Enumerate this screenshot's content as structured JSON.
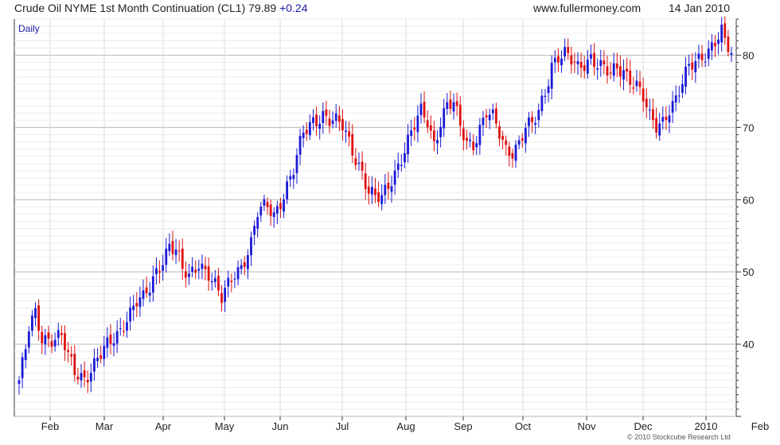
{
  "header": {
    "instrument": "Crude Oil NYME 1st Month Continuation (CL1)",
    "last_price": "79.89",
    "change": "+0.24",
    "website": "www.fullermoney.com",
    "date": "14 Jan 2010"
  },
  "period_label": "Daily",
  "copyright": "© 2010 Stockcube Research Ltd",
  "colors": {
    "up": "#1a1ad6",
    "down": "#e01010",
    "grid": "#d8d8d8",
    "axis": "#333333",
    "change": "#1a1aa8"
  },
  "chart_data": {
    "type": "candlestick",
    "y_axis_side": "right",
    "ylim": [
      30,
      85
    ],
    "y_ticks": [
      40,
      50,
      60,
      70,
      80
    ],
    "x_ticks": [
      "Feb",
      "Mar",
      "Apr",
      "May",
      "Jun",
      "Jul",
      "Aug",
      "Sep",
      "Oct",
      "Nov",
      "Dec",
      "2010",
      "Feb"
    ],
    "grid": true,
    "close_path": [
      [
        0,
        35
      ],
      [
        2,
        39
      ],
      [
        3,
        42
      ],
      [
        5,
        44
      ],
      [
        7,
        41
      ],
      [
        10,
        41
      ],
      [
        13,
        41
      ],
      [
        15,
        38
      ],
      [
        17,
        36
      ],
      [
        20,
        35.5
      ],
      [
        24,
        38
      ],
      [
        28,
        40
      ],
      [
        31,
        42
      ],
      [
        33,
        44
      ],
      [
        36,
        46
      ],
      [
        38,
        46
      ],
      [
        40,
        47.5
      ],
      [
        42,
        50
      ],
      [
        44,
        52
      ],
      [
        46,
        54
      ],
      [
        48,
        53
      ],
      [
        50,
        50
      ],
      [
        52,
        49
      ],
      [
        55,
        51.5
      ],
      [
        58,
        50
      ],
      [
        60,
        48
      ],
      [
        62,
        46
      ],
      [
        64,
        48
      ],
      [
        66,
        50
      ],
      [
        68,
        51
      ],
      [
        71,
        54
      ],
      [
        73,
        58
      ],
      [
        76,
        59
      ],
      [
        78,
        58
      ],
      [
        81,
        61
      ],
      [
        84,
        64
      ],
      [
        87,
        69
      ],
      [
        90,
        71
      ],
      [
        93,
        72
      ],
      [
        95,
        71
      ],
      [
        97,
        70.5
      ],
      [
        99,
        70
      ],
      [
        101,
        68
      ],
      [
        103,
        66
      ],
      [
        105,
        64
      ],
      [
        107,
        61
      ],
      [
        109,
        60
      ],
      [
        111,
        60
      ],
      [
        113,
        62
      ],
      [
        115,
        64
      ],
      [
        117,
        66
      ],
      [
        119,
        68
      ],
      [
        121,
        70
      ],
      [
        123,
        72
      ],
      [
        125,
        71
      ],
      [
        127,
        68
      ],
      [
        129,
        71
      ],
      [
        131,
        73
      ],
      [
        133,
        73
      ],
      [
        135,
        70
      ],
      [
        137,
        68
      ],
      [
        139,
        68
      ],
      [
        141,
        70
      ],
      [
        143,
        72
      ],
      [
        145,
        71
      ],
      [
        147,
        69
      ],
      [
        149,
        67
      ],
      [
        151,
        67
      ],
      [
        153,
        68
      ],
      [
        155,
        70
      ],
      [
        157,
        70
      ],
      [
        159,
        72
      ],
      [
        161,
        75
      ],
      [
        163,
        79
      ],
      [
        165,
        80
      ],
      [
        167,
        80
      ],
      [
        169,
        79
      ],
      [
        171,
        78
      ],
      [
        173,
        79
      ],
      [
        175,
        80
      ],
      [
        177,
        79
      ],
      [
        179,
        78
      ],
      [
        181,
        77
      ],
      [
        183,
        78
      ],
      [
        185,
        78
      ],
      [
        187,
        77
      ],
      [
        189,
        76
      ],
      [
        191,
        74
      ],
      [
        193,
        71
      ],
      [
        195,
        70
      ],
      [
        197,
        71
      ],
      [
        199,
        73
      ],
      [
        201,
        74
      ],
      [
        203,
        76
      ],
      [
        205,
        78
      ],
      [
        207,
        79
      ],
      [
        209,
        80
      ],
      [
        211,
        81
      ],
      [
        213,
        82
      ],
      [
        215,
        83
      ],
      [
        216,
        81.5
      ],
      [
        218,
        80
      ]
    ]
  }
}
